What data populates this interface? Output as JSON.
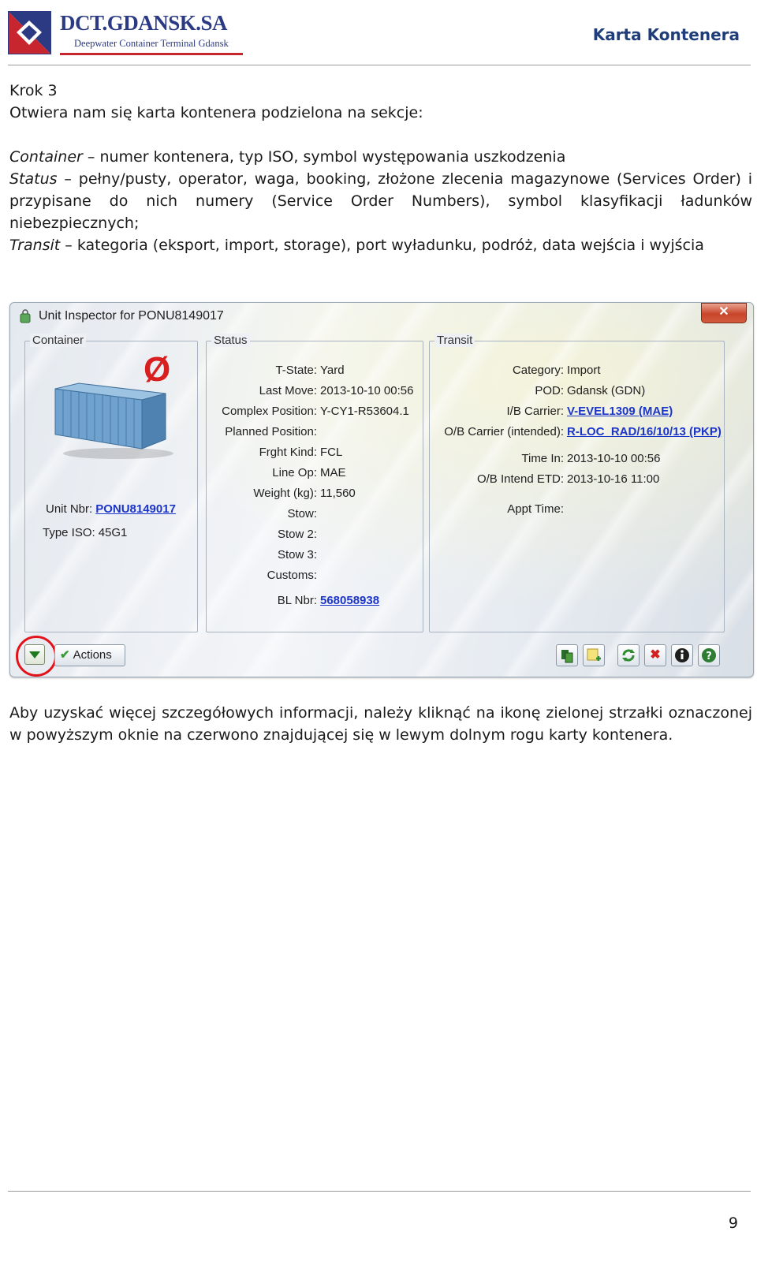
{
  "header": {
    "logo_name": "DCT.GDANSK.SA",
    "logo_tagline": "Deepwater Container Terminal Gdansk",
    "title": "Karta Kontenera"
  },
  "intro": {
    "step": "Krok 3",
    "lead": "Otwiera nam się karta kontenera podzielona na sekcje:"
  },
  "sections": [
    {
      "term": "Container",
      "text": " – numer kontenera, typ ISO, symbol występowania uszkodzenia"
    },
    {
      "term": "Status",
      "text": " – pełny/pusty, operator, waga, booking, złożone zlecenia magazynowe (Services Order) i przypisane do nich numery (Service Order Numbers), symbol klasyfikacji ładunków niebezpiecznych;"
    },
    {
      "term": "Transit",
      "text": " – kategoria (eksport, import, storage), port wyładunku, podróż, data wejścia i wyjścia"
    }
  ],
  "dialog": {
    "title": "Unit Inspector for PONU8149017",
    "close_symbol": "✕",
    "container": {
      "legend": "Container",
      "damage_symbol": "Ø",
      "unit_nbr_label": "Unit Nbr:",
      "unit_nbr_value": "PONU8149017",
      "type_iso_label": "Type ISO:",
      "type_iso_value": "45G1"
    },
    "status": {
      "legend": "Status",
      "rows": [
        {
          "label": "T-State:",
          "value": "Yard"
        },
        {
          "label": "Last Move:",
          "value": "2013-10-10 00:56"
        },
        {
          "label": "Complex Position:",
          "value": "Y-CY1-R53604.1"
        },
        {
          "label": "Planned Position:",
          "value": ""
        },
        {
          "label": "Frght Kind:",
          "value": "FCL"
        },
        {
          "label": "Line Op:",
          "value": "MAE"
        },
        {
          "label": "Weight (kg):",
          "value": "11,560"
        },
        {
          "label": "Stow:",
          "value": ""
        },
        {
          "label": "Stow 2:",
          "value": ""
        },
        {
          "label": "Stow 3:",
          "value": ""
        },
        {
          "label": "Customs:",
          "value": ""
        },
        {
          "label": "BL Nbr:",
          "value": "568058938"
        }
      ]
    },
    "transit": {
      "legend": "Transit",
      "rows": [
        {
          "label": "Category:",
          "value": "Import"
        },
        {
          "label": "POD:",
          "value": "Gdansk (GDN)"
        },
        {
          "label": "I/B Carrier:",
          "value": "V-EVEL1309 (MAE)"
        },
        {
          "label": "O/B Carrier (intended):",
          "value": "R-LOC  RAD/16/10/13 (PKP)"
        },
        {
          "label": "Time In:",
          "value": "2013-10-10 00:56"
        },
        {
          "label": "O/B Intend ETD:",
          "value": "2013-10-16 11:00"
        },
        {
          "label": "Appt Time:",
          "value": ""
        }
      ]
    },
    "actions_label": "Actions",
    "toolbar_icons": [
      "copy-icon",
      "add-note-icon",
      "refresh-icon",
      "delete-icon",
      "info-icon",
      "help-icon"
    ],
    "colors": {
      "link": "#1c35c9",
      "highlight_circle": "#e0141a",
      "damage": "#d81e1e"
    }
  },
  "note": "Aby uzyskać więcej szczegółowych informacji, należy kliknąć na ikonę zielonej strzałki oznaczonej w powyższym oknie na czerwono znajdującej się w lewym dolnym rogu karty kontenera.",
  "footer": {
    "page_number": "9"
  }
}
